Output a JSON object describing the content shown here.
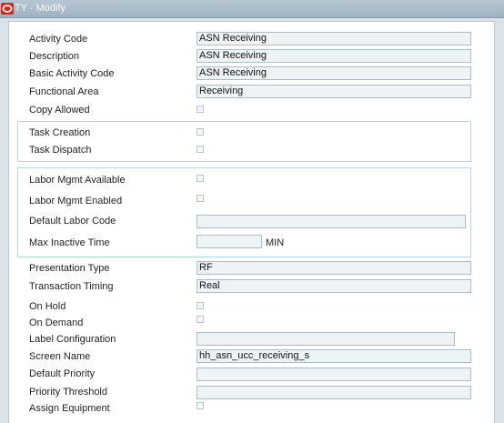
{
  "window": {
    "title": "TY - Modify"
  },
  "form": {
    "activity_code": {
      "label": "Activity Code",
      "value": "ASN Receiving"
    },
    "description": {
      "label": "Description",
      "value": "ASN Receiving"
    },
    "basic_activity_code": {
      "label": "Basic Activity Code",
      "value": "ASN Receiving"
    },
    "functional_area": {
      "label": "Functional Area",
      "value": "Receiving"
    },
    "copy_allowed": {
      "label": "Copy Allowed",
      "checked": false
    },
    "task_creation": {
      "label": "Task Creation",
      "checked": false
    },
    "task_dispatch": {
      "label": "Task Dispatch",
      "checked": false
    },
    "labor_mgmt_available": {
      "label": "Labor Mgmt Available",
      "checked": false
    },
    "labor_mgmt_enabled": {
      "label": "Labor Mgmt Enabled",
      "checked": false
    },
    "default_labor_code": {
      "label": "Default Labor Code",
      "value": ""
    },
    "max_inactive_time": {
      "label": "Max Inactive Time",
      "value": "",
      "unit": "MIN"
    },
    "presentation_type": {
      "label": "Presentation Type",
      "value": "RF"
    },
    "transaction_timing": {
      "label": "Transaction Timing",
      "value": "Real"
    },
    "on_hold": {
      "label": "On Hold",
      "checked": false
    },
    "on_demand": {
      "label": "On Demand",
      "checked": false
    },
    "label_configuration": {
      "label": "Label Configuration",
      "value": ""
    },
    "screen_name": {
      "label": "Screen Name",
      "value": "hh_asn_ucc_receiving_s"
    },
    "default_priority": {
      "label": "Default Priority",
      "value": ""
    },
    "priority_threshold": {
      "label": "Priority Threshold",
      "value": ""
    },
    "assign_equipment": {
      "label": "Assign Equipment",
      "checked": false
    }
  }
}
